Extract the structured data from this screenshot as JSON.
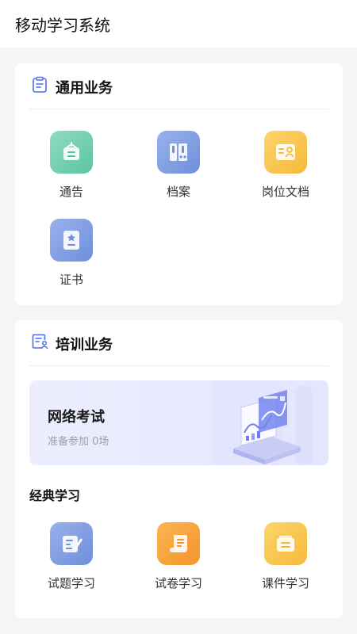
{
  "app": {
    "title": "移动学习系统"
  },
  "general": {
    "title": "通用业务",
    "header_icon": "clipboard-icon",
    "items": [
      {
        "label": "通告",
        "icon": "notice-icon",
        "color": "#6cc9ab"
      },
      {
        "label": "档案",
        "icon": "archive-icon",
        "color": "#7f9ae0"
      },
      {
        "label": "岗位文档",
        "icon": "post-document-icon",
        "color": "#f7c24a"
      },
      {
        "label": "证书",
        "icon": "certificate-icon",
        "color": "#7f9ae0"
      }
    ]
  },
  "training": {
    "title": "培训业务",
    "header_icon": "training-doc-icon",
    "banner": {
      "title": "网络考试",
      "subtitle": "准备参加 0场"
    },
    "classic_label": "经典学习",
    "items": [
      {
        "label": "试题学习",
        "icon": "question-study-icon",
        "color": "#7f9ae0"
      },
      {
        "label": "试卷学习",
        "icon": "paper-study-icon",
        "color": "#f6a43a"
      },
      {
        "label": "课件学习",
        "icon": "courseware-study-icon",
        "color": "#f7c24a"
      }
    ]
  },
  "colors": {
    "background": "#f4f5f7",
    "accent": "#4a6cf7"
  }
}
